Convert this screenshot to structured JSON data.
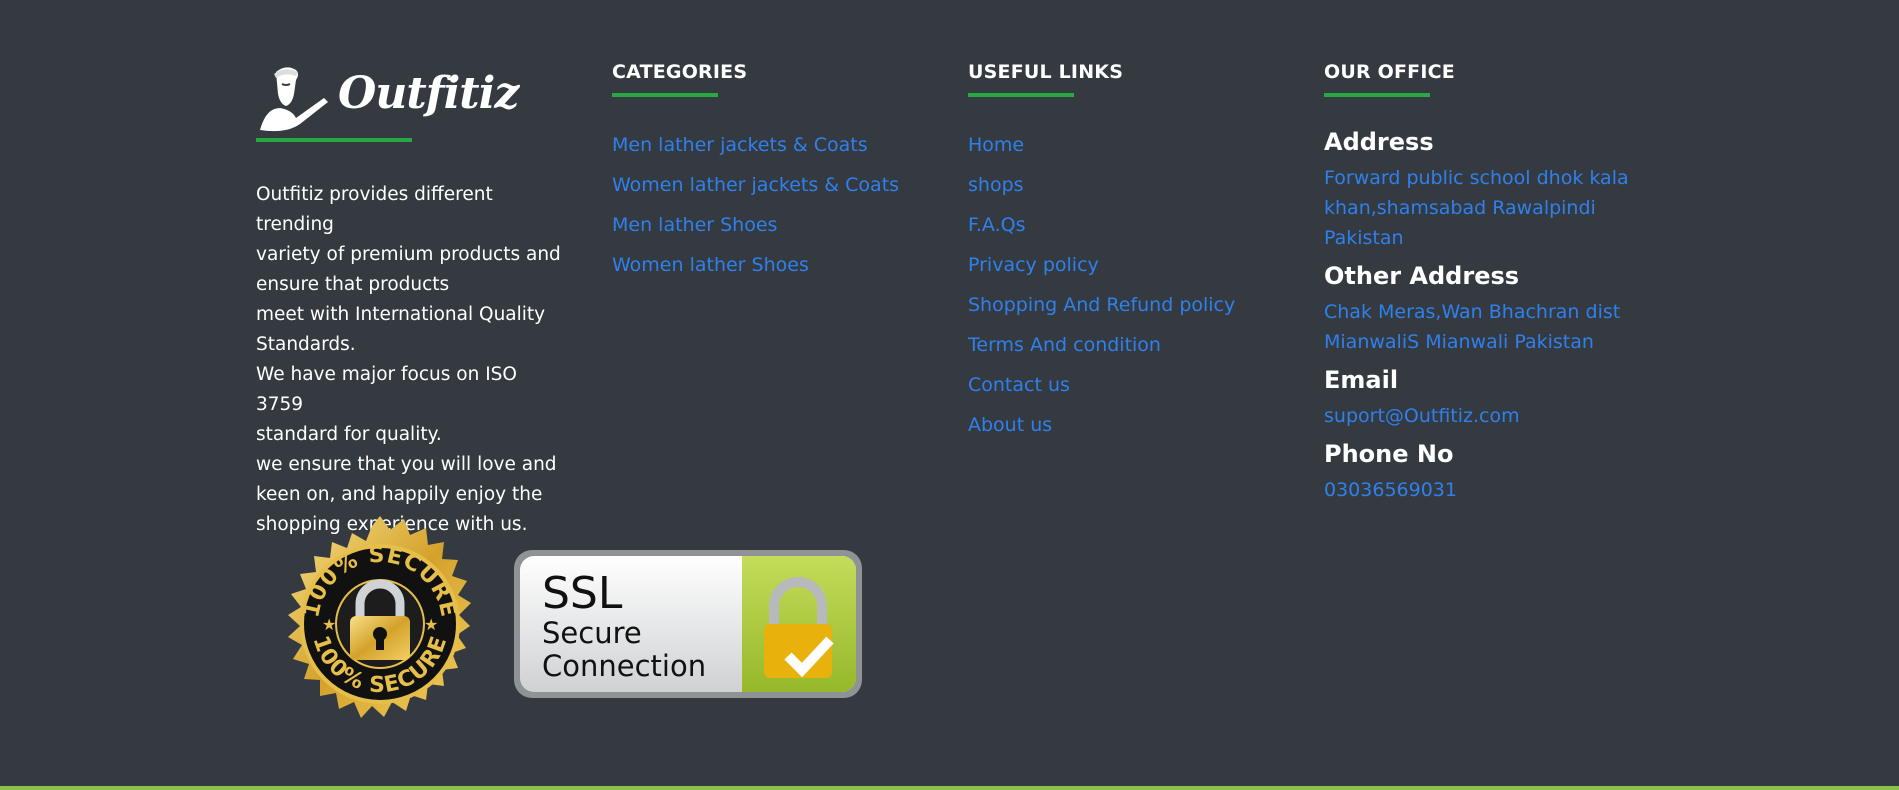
{
  "brand": {
    "name": "Outfitiz"
  },
  "about": {
    "lines": [
      "Outfitiz provides different trending",
      "variety of premium products and",
      "ensure that products",
      "meet with International Quality",
      "Standards.",
      "We have major focus on ISO 3759",
      "standard for quality.",
      "we ensure that you will love and",
      "keen on, and happily enjoy the",
      "shopping experience with us."
    ]
  },
  "categories": {
    "heading": "CATEGORIES",
    "items": [
      "Men lather jackets & Coats",
      "Women lather jackets & Coats",
      "Men lather Shoes",
      "Women lather Shoes"
    ]
  },
  "useful_links": {
    "heading": "USEFUL LINKS",
    "items": [
      "Home",
      "shops",
      "F.A.Qs",
      "Privacy policy",
      "Shopping And Refund policy",
      "Terms And condition",
      "Contact us",
      "About us"
    ]
  },
  "office": {
    "heading": "OUR OFFICE",
    "address_title": "Address",
    "address_value": "Forward public school dhok kala khan,shamsabad Rawalpindi Pakistan",
    "other_title": "Other Address",
    "other_value": "Chak Meras,Wan Bhachran dist MianwaliS Mianwali Pakistan",
    "email_title": "Email",
    "email_value": "suport@Outfitiz.com",
    "phone_title": "Phone No",
    "phone_value": "03036569031"
  },
  "badges": {
    "seal_text": "100% SECURE",
    "ssl_line1": "SSL",
    "ssl_line2": "Secure",
    "ssl_line3": "Connection"
  },
  "colors": {
    "background": "#343a40",
    "link": "#2f80ed",
    "accent": "#28a745",
    "bottom_bar": "#8bc34a"
  }
}
